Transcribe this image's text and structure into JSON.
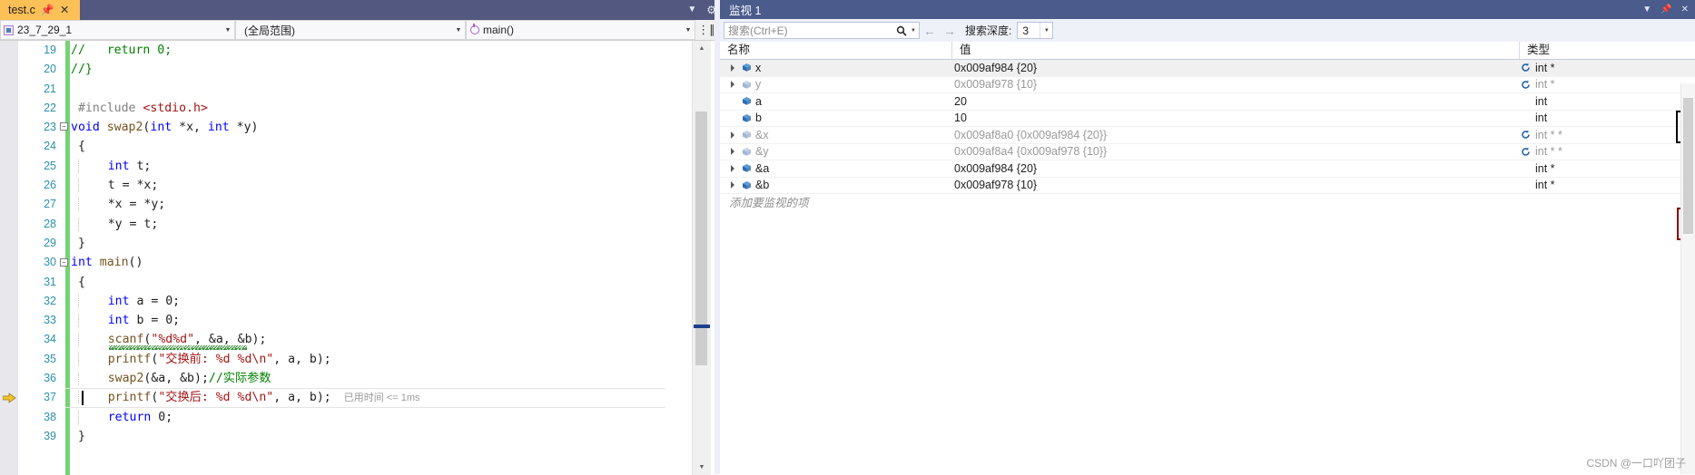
{
  "editor": {
    "tab": {
      "title": "test.c",
      "pin_icon": "pin-icon",
      "close_icon": "close-icon"
    },
    "tabstrip_icons": [
      "chevron-down-icon",
      "gear-icon"
    ],
    "navbar": {
      "document_value": "23_7_29_1",
      "scope_value": "(全局范围)",
      "member_value": "main()",
      "split_icon": "split-view-icon"
    },
    "elapsed_annotation": "已用时间 <= 1ms",
    "first_line_number": 19,
    "lines": [
      {
        "n": 19,
        "text": "//   return 0;"
      },
      {
        "n": 20,
        "text": "//}"
      },
      {
        "n": 21,
        "text": ""
      },
      {
        "n": 22,
        "text": "#include <stdio.h>"
      },
      {
        "n": 23,
        "text": "void swap2(int *x, int *y)"
      },
      {
        "n": 24,
        "text": "{"
      },
      {
        "n": 25,
        "text": "    int t;"
      },
      {
        "n": 26,
        "text": "    t = *x;"
      },
      {
        "n": 27,
        "text": "    *x = *y;"
      },
      {
        "n": 28,
        "text": "    *y = t;"
      },
      {
        "n": 29,
        "text": "}"
      },
      {
        "n": 30,
        "text": "int main()"
      },
      {
        "n": 31,
        "text": "{"
      },
      {
        "n": 32,
        "text": "    int a = 0;"
      },
      {
        "n": 33,
        "text": "    int b = 0;"
      },
      {
        "n": 34,
        "text": "    scanf(\"%d%d\", &a, &b);"
      },
      {
        "n": 35,
        "text": "    printf(\"交换前: %d %d\\n\", a, b);"
      },
      {
        "n": 36,
        "text": "    swap2(&a, &b);//实际参数"
      },
      {
        "n": 37,
        "text": "    printf(\"交换后: %d %d\\n\", a, b);"
      },
      {
        "n": 38,
        "text": "    return 0;"
      },
      {
        "n": 39,
        "text": "}"
      }
    ],
    "current_execution_line": 37
  },
  "watch": {
    "title": "监视 1",
    "title_icons": [
      "chevron-down-icon",
      "pin-icon",
      "close-icon"
    ],
    "search_placeholder": "搜索(Ctrl+E)",
    "search_value": "",
    "search_icon": "search-icon",
    "prev_icon": "arrow-left-icon",
    "next_icon": "arrow-right-icon",
    "depth_label": "搜索深度:",
    "depth_value": "3",
    "columns": {
      "name": "名称",
      "value": "值",
      "type": "类型"
    },
    "rows": [
      {
        "name": "x",
        "value": "0x009af984 {20}",
        "type": "int *",
        "expandable": true,
        "dimmed": false,
        "refresh": true,
        "selected": true
      },
      {
        "name": "y",
        "value": "0x009af978 {10}",
        "type": "int *",
        "expandable": true,
        "dimmed": true,
        "refresh": true,
        "selected": false
      },
      {
        "name": "a",
        "value": "20",
        "type": "int",
        "expandable": false,
        "dimmed": false,
        "refresh": false,
        "selected": false
      },
      {
        "name": "b",
        "value": "10",
        "type": "int",
        "expandable": false,
        "dimmed": false,
        "refresh": false,
        "selected": false
      },
      {
        "name": "&x",
        "value": "0x009af8a0 {0x009af984 {20}}",
        "type": "int * *",
        "expandable": true,
        "dimmed": true,
        "refresh": true,
        "selected": false
      },
      {
        "name": "&y",
        "value": "0x009af8a4 {0x009af978 {10}}",
        "type": "int * *",
        "expandable": true,
        "dimmed": true,
        "refresh": true,
        "selected": false
      },
      {
        "name": "&a",
        "value": "0x009af984 {20}",
        "type": "int *",
        "expandable": true,
        "dimmed": false,
        "refresh": false,
        "selected": false
      },
      {
        "name": "&b",
        "value": "0x009af978 {10}",
        "type": "int *",
        "expandable": true,
        "dimmed": false,
        "refresh": false,
        "selected": false
      }
    ],
    "add_item_placeholder": "添加要监视的项",
    "highlight_boxes": [
      {
        "name": "black-highlight-box",
        "color": "#000000",
        "covers": [
          "x",
          "y"
        ]
      },
      {
        "name": "red-highlight-box",
        "color": "#8b0000",
        "covers": [
          "&a",
          "&b"
        ]
      }
    ]
  },
  "watermark": "CSDN @一口吖团子",
  "colors": {
    "tab_active": "#fdc056",
    "titlebar": "#4a5b8c",
    "tabstrip": "#52587f",
    "change_bar": "#76d275",
    "linenum": "#2b91af",
    "keyword": "#0000ff",
    "string": "#a31515",
    "comment": "#008000",
    "function": "#74531f"
  }
}
